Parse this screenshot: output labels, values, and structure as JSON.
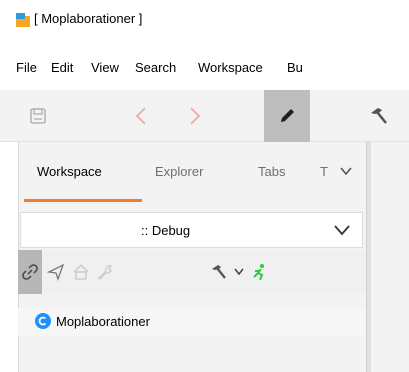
{
  "window": {
    "title": "[ Moplaborationer ]"
  },
  "menu": [
    "File",
    "Edit",
    "View",
    "Search",
    "Workspace",
    "Bu"
  ],
  "toolbar": {
    "buttons": [
      "save-icon",
      "back-chevron-icon",
      "forward-chevron-icon",
      "edit-pencil-icon",
      "build-hammer-icon"
    ],
    "active": "edit-pencil-icon"
  },
  "tabs": [
    {
      "label": "Workspace",
      "active": true
    },
    {
      "label": "Explorer",
      "active": false
    },
    {
      "label": "Tabs",
      "active": false
    },
    {
      "label": "T",
      "active": false
    }
  ],
  "config_combo": {
    "value": ":: Debug"
  },
  "sub_toolbar": {
    "buttons": [
      "link-icon",
      "send-icon",
      "home-icon",
      "wrench-icon",
      "hammer-icon",
      "chevron-down-icon",
      "run-icon"
    ],
    "active": "link-icon"
  },
  "tree": [
    {
      "label": "Moplaborationer",
      "icon": "project-icon"
    }
  ],
  "colors": {
    "accent": "#f07d2f",
    "toolbar_bg": "#f3f3f3",
    "active_btn": "#bdbdbd",
    "project_icon": "#1e90ff",
    "run_icon": "#2ecc40"
  }
}
